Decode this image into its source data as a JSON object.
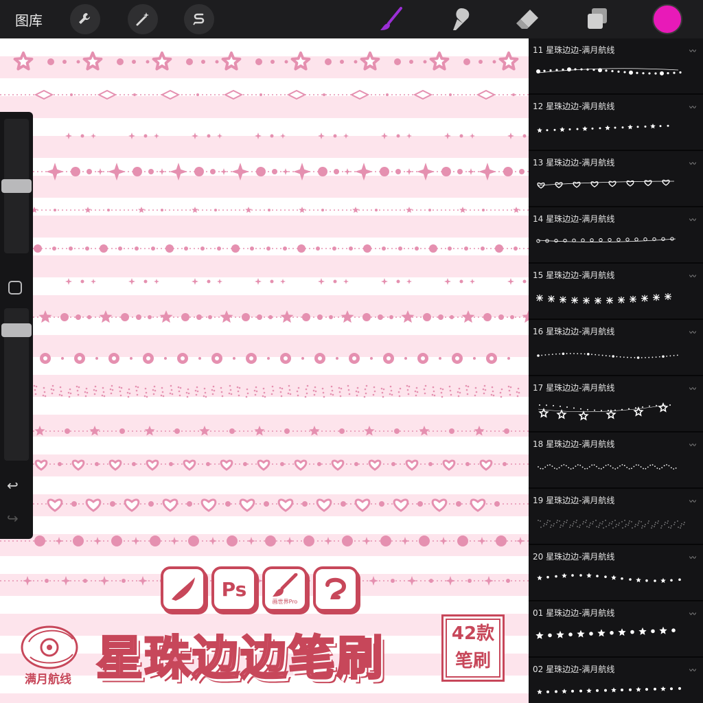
{
  "toolbar": {
    "gallery_label": "图库",
    "tools": [
      "wrench-icon",
      "magic-wand-icon",
      "selection-s-icon"
    ],
    "active_color": "#e81ab8"
  },
  "colors": {
    "pink": "#e590b0",
    "panel": "#141416",
    "accent": "#9b2fd6"
  },
  "canvas": {
    "rows": [
      {
        "motif": "star-outline-dots"
      },
      {
        "motif": "diamond-dots"
      },
      {
        "motif": "moons-sparkles"
      },
      {
        "motif": "sparkle-bursts"
      },
      {
        "motif": "tiny-star-line"
      },
      {
        "motif": "dots-line"
      },
      {
        "motif": "moons-sparkles"
      },
      {
        "motif": "stars-dots"
      },
      {
        "motif": "sparkle-circles"
      },
      {
        "motif": "speckle"
      },
      {
        "motif": "stars-line"
      },
      {
        "motif": "hearts-line"
      },
      {
        "motif": "hearts-outline"
      },
      {
        "motif": "circles-sparkles"
      },
      {
        "motif": "sparkle-line"
      }
    ]
  },
  "promo": {
    "title": "星珠边边笔刷",
    "badge_top": "42款",
    "badge_bottom": "笔刷",
    "logo_label": "满月航线",
    "apps": [
      {
        "name": "procreate",
        "label": ""
      },
      {
        "name": "photoshop",
        "label": "Ps"
      },
      {
        "name": "huashijie",
        "label": "画世界Pro"
      },
      {
        "name": "clip-studio",
        "label": ""
      }
    ]
  },
  "brushes": [
    {
      "name": "11 星珠边边-满月航线",
      "style": "dots"
    },
    {
      "name": "12 星珠边边-满月航线",
      "style": "stars"
    },
    {
      "name": "13 星珠边边-满月航线",
      "style": "hearts"
    },
    {
      "name": "14 星珠边边-满月航线",
      "style": "chain"
    },
    {
      "name": "15 星珠边边-满月航线",
      "style": "snow"
    },
    {
      "name": "16 星珠边边-满月航线",
      "style": "tiny"
    },
    {
      "name": "17 星珠边边-满月航线",
      "style": "bigstars"
    },
    {
      "name": "18 星珠边边-满月航线",
      "style": "speck"
    },
    {
      "name": "19 星珠边边-满月航线",
      "style": "dust"
    },
    {
      "name": "20 星珠边边-满月航线",
      "style": "sparkdots"
    },
    {
      "name": "01 星珠边边-满月航线",
      "style": "starsbig"
    },
    {
      "name": "02 星珠边边-满月航线",
      "style": "stardots"
    }
  ]
}
